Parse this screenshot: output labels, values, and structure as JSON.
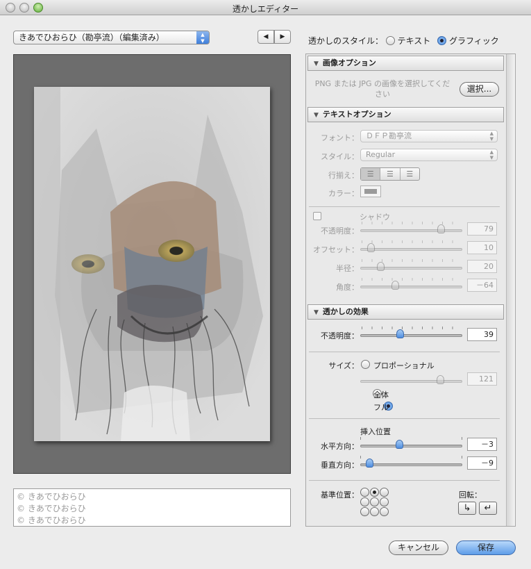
{
  "window": {
    "title": "透かしエディター"
  },
  "preset": {
    "value": "きあでひおらひ（勘亭流）（編集済み）"
  },
  "nav": {
    "prev": "◀",
    "next": "▶"
  },
  "style": {
    "label": "透かしのスタイル：",
    "text_option": "テキスト",
    "graphic_option": "グラフィック",
    "selected": "graphic"
  },
  "image_options": {
    "header": "画像オプション",
    "hint": "PNG または JPG の画像を選択してください",
    "choose_button": "選択..."
  },
  "text_options": {
    "header": "テキストオプション",
    "font_label": "フォント：",
    "font_value": "ＤＦＰ勘亭流",
    "style_label": "スタイル：",
    "style_value": "Regular",
    "align_label": "行揃え：",
    "color_label": "カラー："
  },
  "shadow": {
    "label": "シャドウ",
    "opacity_label": "不透明度：",
    "opacity": "79",
    "offset_label": "オフセット：",
    "offset": "10",
    "radius_label": "半径：",
    "radius": "20",
    "angle_label": "角度：",
    "angle": "－64"
  },
  "effects": {
    "header": "透かしの効果",
    "opacity_label": "不透明度：",
    "opacity": "39",
    "size_label": "サイズ：",
    "proportional": "プロポーショナル",
    "proportional_value": "121",
    "fit_label": "全体",
    "fill_label": "フル",
    "inset_label": "挿入位置",
    "horizontal_label": "水平方向：",
    "horizontal": "－3",
    "vertical_label": "垂直方向：",
    "vertical": "－9",
    "anchor_label": "基準位置：",
    "rotate_label": "回転："
  },
  "watermark_text": [
    "© きあでひおらひ",
    "© きあでひおらひ",
    "© きあでひおらひ"
  ],
  "buttons": {
    "cancel": "キャンセル",
    "save": "保存"
  },
  "slider_levels": {
    "shadow_opacity": 0.79,
    "shadow_offset": 0.1,
    "shadow_radius": 0.2,
    "shadow_angle": 0.34,
    "effect_opacity": 0.39,
    "proportional": 0.78,
    "horizontal": 0.38,
    "vertical": 0.09
  },
  "colors": {
    "accent": "#4f8ee0",
    "preview_bg": "#6d6d6d"
  }
}
